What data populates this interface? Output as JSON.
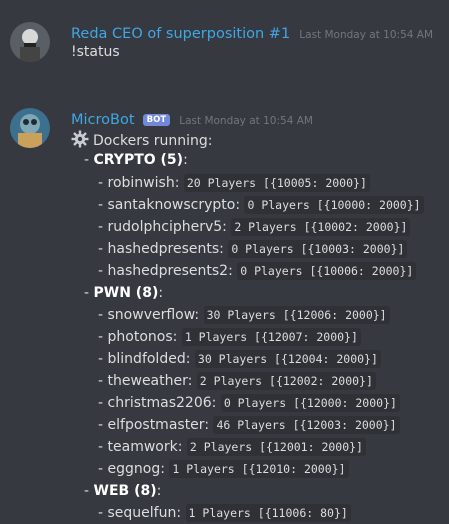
{
  "messages": [
    {
      "username": "Reda CEO of superposition #1",
      "username_color": "#3fa7e6",
      "timestamp": "Last Monday at 10:54 AM",
      "text": "!status"
    },
    {
      "username": "MicroBot",
      "username_color": "#3fa7e6",
      "bot_tag": "BOT",
      "timestamp": "Last Monday at 10:54 AM",
      "heading_icon": "gear-icon",
      "heading": "Dockers running:"
    }
  ],
  "categories": [
    {
      "name": "CRYPTO (5)",
      "items": [
        {
          "name": "robinwish",
          "stats": "20 Players [{10005: 2000}]"
        },
        {
          "name": "santaknowscrypto",
          "stats": "0 Players [{10000: 2000}]"
        },
        {
          "name": "rudolphcipherv5",
          "stats": "2 Players [{10002: 2000}]"
        },
        {
          "name": "hashedpresents",
          "stats": "0 Players [{10003: 2000}]"
        },
        {
          "name": "hashedpresents2",
          "stats": "0 Players [{10006: 2000}]"
        }
      ]
    },
    {
      "name": "PWN (8)",
      "items": [
        {
          "name": "snowverflow",
          "stats": "30 Players [{12006: 2000}]"
        },
        {
          "name": "photonos",
          "stats": "1 Players [{12007: 2000}]"
        },
        {
          "name": "blindfolded",
          "stats": "30 Players [{12004: 2000}]"
        },
        {
          "name": "theweather",
          "stats": "2 Players [{12002: 2000}]"
        },
        {
          "name": "christmas2206",
          "stats": "0 Players [{12000: 2000}]"
        },
        {
          "name": "elfpostmaster",
          "stats": "46 Players [{12003: 2000}]"
        },
        {
          "name": "teamwork",
          "stats": "2 Players [{12001: 2000}]"
        },
        {
          "name": "eggnog",
          "stats": "1 Players [{12010: 2000}]"
        }
      ]
    },
    {
      "name": "WEB (8)",
      "items": [
        {
          "name": "sequelfun",
          "stats": "1 Players [{11006: 80}]"
        }
      ]
    }
  ]
}
